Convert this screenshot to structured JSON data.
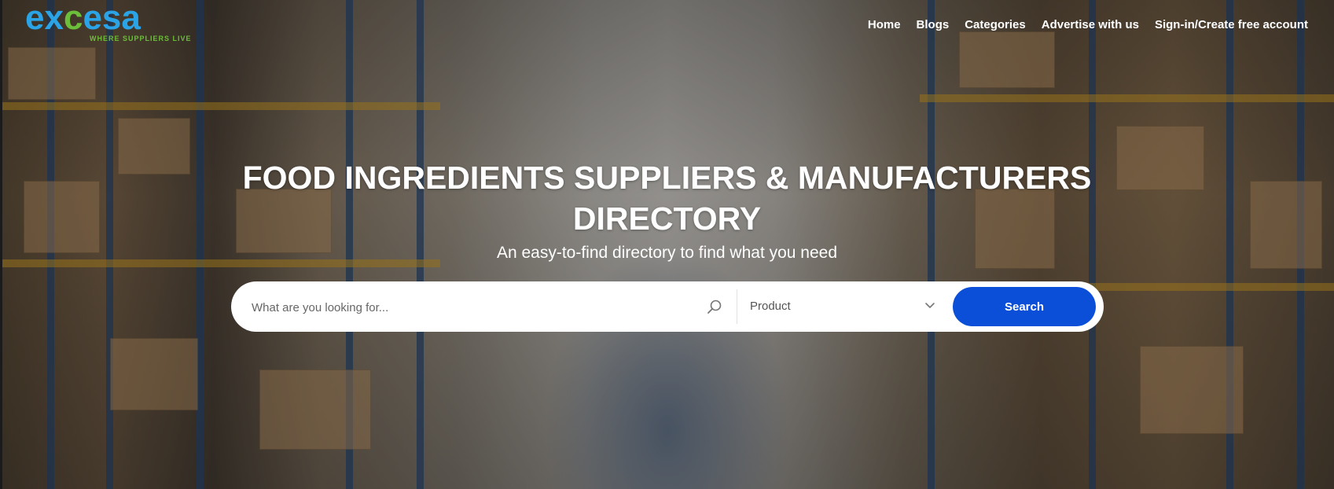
{
  "brand": {
    "logo_text_a": "ex",
    "logo_text_c": "c",
    "logo_text_b": "esa",
    "tagline": "WHERE SUPPLIERS LIVE"
  },
  "nav": {
    "items": [
      {
        "label": "Home"
      },
      {
        "label": "Blogs"
      },
      {
        "label": "Categories"
      },
      {
        "label": "Advertise with us"
      },
      {
        "label": "Sign-in/Create free account"
      }
    ]
  },
  "hero": {
    "headline_line1": "FOOD INGREDIENTS SUPPLIERS & MANUFACTURERS",
    "headline_line2": "DIRECTORY",
    "subheadline": "An easy-to-find directory to find what you need"
  },
  "search": {
    "placeholder": "What are you looking for...",
    "value": "",
    "category_selected": "Product",
    "button_label": "Search"
  },
  "colors": {
    "brand_blue": "#2aa4e6",
    "brand_green": "#6cbd3a",
    "button_blue": "#0b4fd8"
  },
  "icons": {
    "search": "search-icon",
    "dropdown": "chevron-down-icon"
  }
}
